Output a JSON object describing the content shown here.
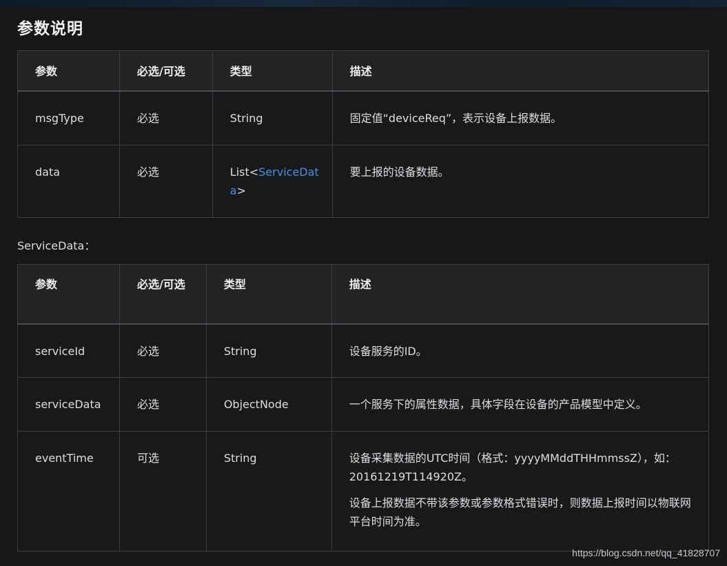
{
  "page": {
    "title": "参数说明"
  },
  "table1": {
    "headers": [
      "参数",
      "必选/可选",
      "类型",
      "描述"
    ],
    "rows": [
      {
        "param": "msgType",
        "required": "必选",
        "type": "String",
        "desc": "固定值“deviceReq”，表示设备上报数据。"
      },
      {
        "param": "data",
        "required": "必选",
        "type_prefix": "List<",
        "type_link": "ServiceData",
        "type_suffix": ">",
        "desc": "要上报的设备数据。"
      }
    ]
  },
  "service_data_label": "ServiceData：",
  "table2": {
    "headers": [
      "参数",
      "必选/可选",
      "类型",
      "描述"
    ],
    "rows": [
      {
        "param": "serviceId",
        "required": "必选",
        "type": "String",
        "desc": "设备服务的ID。"
      },
      {
        "param": "serviceData",
        "required": "必选",
        "type": "ObjectNode",
        "desc": "一个服务下的属性数据，具体字段在设备的产品模型中定义。"
      },
      {
        "param": "eventTime",
        "required": "可选",
        "type": "String",
        "desc": "设备采集数据的UTC时间（格式：yyyyMMddTHHmmssZ），如：20161219T114920Z。",
        "desc_note": "设备上报数据不带该参数或参数格式错误时，则数据上报时间以物联网平台时间为准。"
      }
    ]
  },
  "watermark": "https://blog.csdn.net/qq_41828707",
  "colors": {
    "background": "#161719",
    "header_background": "#212325",
    "border": "#3b3e43",
    "link": "#4a8fe0",
    "text": "#dcdee1"
  }
}
